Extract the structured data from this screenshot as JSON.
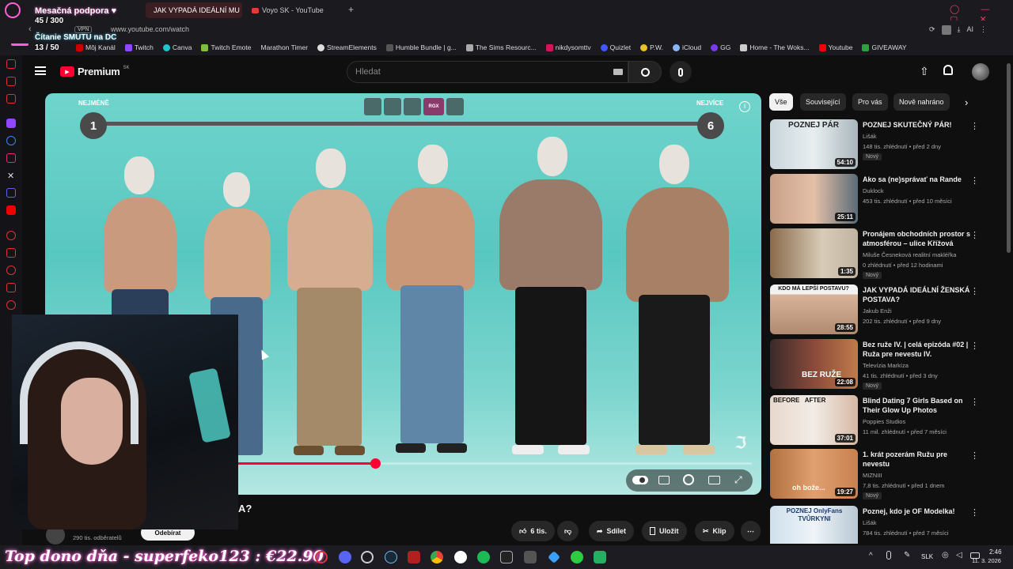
{
  "browser": {
    "tabs": [
      {
        "label": "JAK VYPADÁ IDEÁLNÍ MU",
        "active": true
      },
      {
        "label": "Voyo SK - YouTube",
        "active": false
      }
    ],
    "url": "www.youtube.com/watch",
    "vpn_label": "VPN",
    "bookmarks": [
      "Môj Kanál",
      "Twitch",
      "Canva",
      "Twitch Emote",
      "Marathon Timer",
      "StreamElements",
      "Humble Bundle | g...",
      "The Sims Resourc...",
      "nikdysomttv",
      "Quizlet",
      "P.W.",
      "iCloud",
      "GG",
      "Home - The Woks...",
      "Youtube",
      "GIVEAWAY"
    ],
    "ai_label": "AI"
  },
  "overlay": {
    "support_label": "Mesačná podpora ♥",
    "support_count": "45 / 300",
    "sadness_label": "Čítanie SMUTU na DC",
    "sadness_count": "13 / 50",
    "ticker": "Top dono dňa - superfeko123 : €22.90"
  },
  "youtube": {
    "logo_text": "Premium",
    "logo_sup": "SK",
    "search_placeholder": "Hledat",
    "chips": [
      "Vše",
      "Související",
      "Pro vás",
      "Nově nahráno"
    ],
    "player": {
      "label_left": "NEJMÉNĚ",
      "label_right": "NEJVÍCE",
      "scale_start": "1",
      "scale_end": "6",
      "rgx_label": "RGX",
      "progress": 0.46
    },
    "title_fragment": "A?",
    "subscribers": "290 tis. odběratelů",
    "subscribe_label": "Odebírat",
    "actions": {
      "likes": "6 tis.",
      "share": "Sdílet",
      "save": "Uložit",
      "clip": "Klip"
    },
    "recommendations": [
      {
        "title": "POZNEJ SKUTEČNÝ PÁR!",
        "channel": "Lišák",
        "meta": "148 tis. zhlédnutí • před 2 dny",
        "duration": "54:10",
        "badge": "Nový",
        "thumb_text": "POZNEJ PÁR"
      },
      {
        "title": "Ako sa (ne)správať na Rande",
        "channel": "Duklock",
        "meta": "453 tis. zhlédnutí • před 10 měsíci",
        "duration": "25:11",
        "badge": "",
        "thumb_text": ""
      },
      {
        "title": "Pronájem obchodních prostor s atmosférou – ulice Křížová",
        "channel": "Miluše Česneková realitní makléřka",
        "meta": "0 zhlédnutí • před 12 hodinami",
        "duration": "1:35",
        "badge": "Nový",
        "thumb_text": ""
      },
      {
        "title": "JAK VYPADÁ IDEÁLNÍ ŽENSKÁ POSTAVA?",
        "channel": "Jakub Enži",
        "meta": "202 tis. zhlédnutí • před 9 dny",
        "duration": "28:55",
        "badge": "",
        "thumb_text": "KDO MÁ LEPŠÍ POSTAVU?"
      },
      {
        "title": "Bez ruže IV. | celá epizóda #02 | Ruža pre nevestu IV.",
        "channel": "Televízia Markíza",
        "meta": "41 tis. zhlédnutí • před 3 dny",
        "duration": "22:08",
        "badge": "Nový",
        "thumb_text": "BEZ RUŽE"
      },
      {
        "title": "Blind Dating 7 Girls Based on Their Glow Up Photos",
        "channel": "Poppies Studios",
        "meta": "11 mil. zhlédnutí • před 7 měsíci",
        "duration": "37:01",
        "badge": "",
        "thumb_text": "BEFORE   AFTER"
      },
      {
        "title": "1. krát pozerám Ružu pre nevestu",
        "channel": "MIZNIII",
        "meta": "7,8 tis. zhlédnutí • před 1 dnem",
        "duration": "19:27",
        "badge": "Nový",
        "thumb_text": "oh bože..."
      },
      {
        "title": "Poznej, kdo je OF Modelka!",
        "channel": "Lišák",
        "meta": "784 tis. zhlédnutí • před 7 měsíci",
        "duration": "",
        "badge": "",
        "thumb_text": "POZNEJ OnlyFans TVŮRKYNI"
      }
    ]
  },
  "taskbar": {
    "lang": "SLK",
    "time": "2:46",
    "date": "11. 3. 2026"
  },
  "colors": {
    "accent_red": "#ff0033",
    "bg": "#0f0f0f",
    "overlay_pink": "#ff5fd2"
  }
}
